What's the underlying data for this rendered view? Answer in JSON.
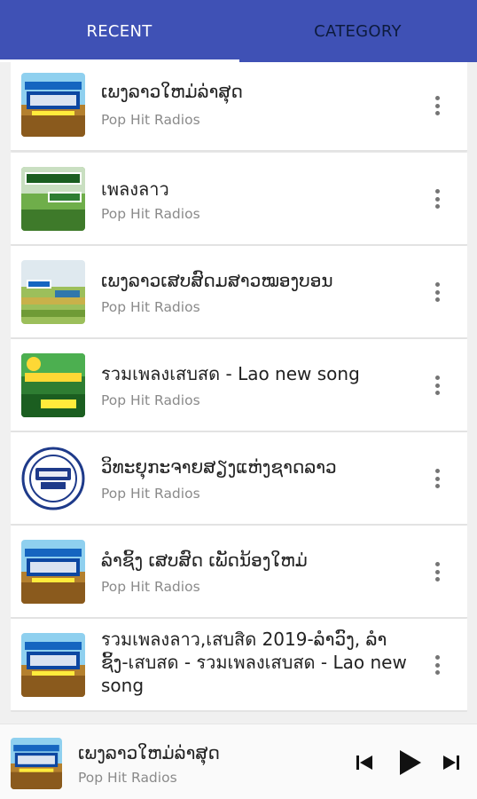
{
  "tabs": [
    {
      "label": "RECENT",
      "active": true
    },
    {
      "label": "CATEGORY",
      "active": false
    }
  ],
  "colors": {
    "app_bar": "#3f51b5",
    "indicator": "#ffffff"
  },
  "stations": [
    {
      "title": "ເພງລາວໃຫມ່ລ່າສຸດ",
      "subtitle": "Pop Hit Radios",
      "icon": "saebsid-logo-thumb"
    },
    {
      "title": "เพลงลาว",
      "subtitle": "Pop Hit Radios",
      "icon": "phlenglao-thumb"
    },
    {
      "title": "ເພງລາວເສບສົດມສາວໝອງບອນ",
      "subtitle": "Pop Hit Radios",
      "icon": "rice-field-thumb"
    },
    {
      "title": "รวมเพลงเสบสด - Lao new song",
      "subtitle": "Pop Hit Radios",
      "icon": "green-field-thumb"
    },
    {
      "title": "ວິທະຍຸກະຈາຍສຽງແຫ່ງຊາດລາວ",
      "subtitle": "Pop Hit Radios",
      "icon": "lnr-logo-thumb"
    },
    {
      "title": "ລຳຊິ້ງ ເສບສົດ ເພັດນ້ອງໃຫມ່",
      "subtitle": "Pop Hit Radios",
      "icon": "saebsid-logo-thumb"
    },
    {
      "title": "รวมเพลงลาว,เสบสิด 2019-ລຳວົງ, ລຳຊິ້ງ-เสบสด - รวมเพลงเสบสด - Lao new song",
      "subtitle": "",
      "icon": "saebsid-logo-thumb"
    }
  ],
  "player": {
    "title": "ເພງລາວໃຫມ່ລ່າສຸດ",
    "subtitle": "Pop Hit Radios",
    "controls": [
      "skip-previous-icon",
      "play-icon",
      "skip-next-icon"
    ]
  }
}
